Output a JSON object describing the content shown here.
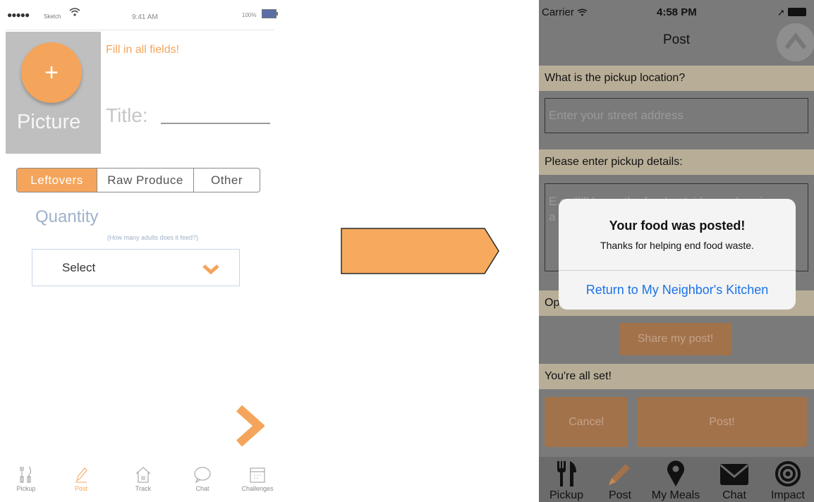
{
  "left_screen": {
    "status_bar": {
      "signal": "●●●●●",
      "carrier": "Sketch",
      "time": "9:41 AM",
      "battery": "100%"
    },
    "picture_label": "Picture",
    "add_picture_symbol": "+",
    "warning": "Fill in all fields!",
    "title_label": "Title:",
    "categories": [
      "Leftovers",
      "Raw Produce",
      "Other"
    ],
    "selected_category": "Leftovers",
    "quantity_label": "Quantity",
    "quantity_hint": "(How many adults does it feed?)",
    "select_value": "Select",
    "tabs": [
      {
        "label": "Pickup",
        "icon": "fork-knife-icon"
      },
      {
        "label": "Post",
        "icon": "pencil-icon"
      },
      {
        "label": "Track",
        "icon": "house-icon"
      },
      {
        "label": "Chat",
        "icon": "chat-bubble-icon"
      },
      {
        "label": "Challenges",
        "icon": "calendar-icon"
      }
    ],
    "active_tab": "Post",
    "accent_color": "#f4a55b"
  },
  "right_screen": {
    "status_bar": {
      "carrier": "Carrier",
      "time": "4:58 PM"
    },
    "nav_title": "Post",
    "location_question": "What is the pickup location?",
    "address_placeholder": "Enter your street address",
    "details_question": "Please enter pickup details:",
    "details_placeholder_visible": "E.g. \"I'll leave the food outside my door in a",
    "details_line2": "a",
    "optional_prefix": "Op",
    "share_button": "Share my post!",
    "all_set": "You're all set!",
    "cancel_button": "Cancel",
    "post_button": "Post!",
    "alert": {
      "title": "Your food was posted!",
      "message": "Thanks for helping end food waste.",
      "button": "Return to My Neighbor's Kitchen"
    },
    "tabs": [
      {
        "label": "Pickup",
        "icon": "fork-knife-icon"
      },
      {
        "label": "Post",
        "icon": "pencil-icon"
      },
      {
        "label": "My Meals",
        "icon": "map-pin-icon"
      },
      {
        "label": "Chat",
        "icon": "envelope-icon"
      },
      {
        "label": "Impact",
        "icon": "target-icon"
      }
    ],
    "active_tab": "Post"
  }
}
